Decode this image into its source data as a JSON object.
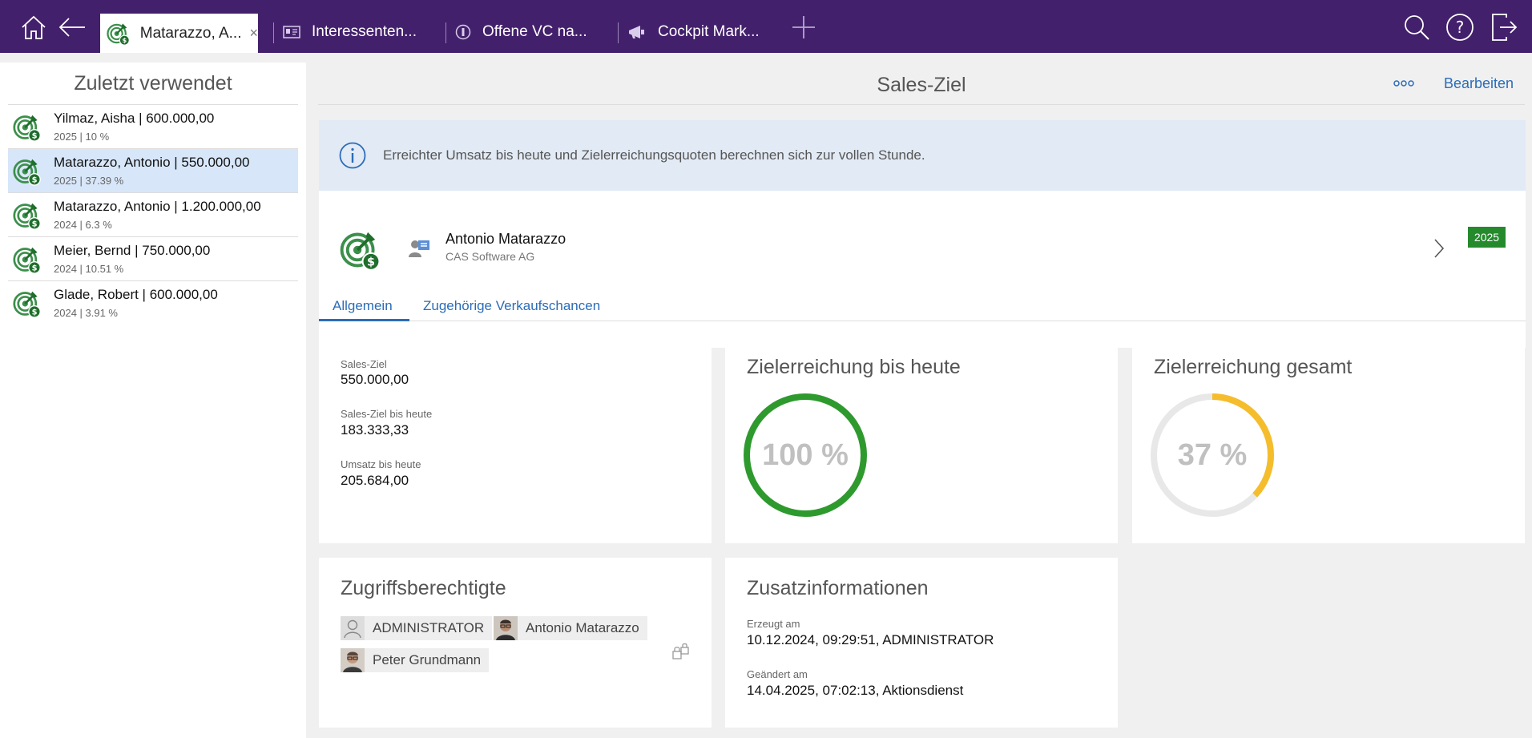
{
  "nav": {
    "tabs": [
      {
        "label": "Matarazzo, A...",
        "active": true,
        "icon": "sales-target-icon"
      },
      {
        "label": "Interessenten...",
        "icon": "contact-card-icon"
      },
      {
        "label": "Offene VC na...",
        "icon": "circle-info-icon"
      },
      {
        "label": "Cockpit Mark...",
        "icon": "megaphone-icon"
      }
    ],
    "accent_color": "#43206c"
  },
  "sidebar": {
    "title": "Zuletzt verwendet",
    "items": [
      {
        "title": "Yilmaz, Aisha | 600.000,00",
        "subtitle": "2025 | 10 %"
      },
      {
        "title": "Matarazzo, Antonio | 550.000,00",
        "subtitle": "2025 | 37.39 %",
        "selected": true
      },
      {
        "title": "Matarazzo, Antonio | 1.200.000,00",
        "subtitle": "2024 | 6.3 %"
      },
      {
        "title": "Meier, Bernd | 750.000,00",
        "subtitle": "2024 | 10.51 %"
      },
      {
        "title": "Glade, Robert | 600.000,00",
        "subtitle": "2024 | 3.91 %"
      }
    ]
  },
  "main": {
    "title": "Sales-Ziel",
    "edit_label": "Bearbeiten",
    "info_text": "Erreichter Umsatz bis heute und Zielerreichungsquoten berechnen sich zur vollen Stunde.",
    "record": {
      "name": "Antonio Matarazzo",
      "company": "CAS Software AG",
      "year": "2025"
    },
    "tabs": [
      "Allgemein",
      "Zugehörige Verkaufschancen"
    ],
    "fields": {
      "sales_ziel_label": "Sales-Ziel",
      "sales_ziel": "550.000,00",
      "bis_heute_label": "Sales-Ziel bis heute",
      "bis_heute": "183.333,33",
      "umsatz_label": "Umsatz bis heute",
      "umsatz": "205.684,00"
    },
    "gauge_today": {
      "title": "Zielerreichung bis heute",
      "label": "100 %",
      "fraction": 1.0,
      "color": "#2e9a2e"
    },
    "gauge_total": {
      "title": "Zielerreichung gesamt",
      "label": "37 %",
      "fraction": 0.37,
      "color": "#f5bd2c"
    },
    "access": {
      "title": "Zugriffsberechtigte",
      "people": [
        "ADMINISTRATOR",
        "Antonio Matarazzo",
        "Peter Grundmann"
      ]
    },
    "extra": {
      "title": "Zusatzinformationen",
      "created_label": "Erzeugt am",
      "created": "10.12.2024, 09:29:51, ADMINISTRATOR",
      "changed_label": "Geändert am",
      "changed": "14.04.2025, 07:02:13, Aktionsdienst"
    }
  }
}
